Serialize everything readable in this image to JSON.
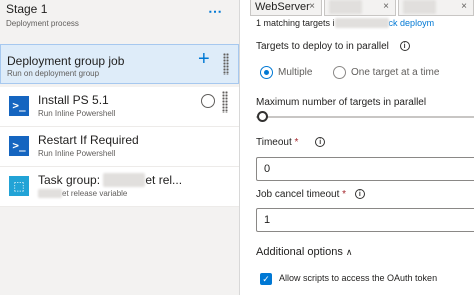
{
  "stage": {
    "title": "Stage 1",
    "subtitle": "Deployment process",
    "more_icon": "⋯"
  },
  "job": {
    "title": "Deployment group job",
    "subtitle": "Run on deployment group",
    "add_icon": "+"
  },
  "tasks": [
    {
      "icon": ">_",
      "title": "Install PS 5.1",
      "subtitle": "Run Inline Powershell"
    },
    {
      "icon": ">_",
      "title": "Restart If Required",
      "subtitle": "Run Inline Powershell"
    },
    {
      "icon": "⬚",
      "title_prefix": "Task group: ",
      "title_redacted": "xxxxxxx",
      "title_suffix": "et rel...",
      "subtitle_redacted": "xxxxxx",
      "subtitle_suffix": "et release variable"
    }
  ],
  "tabs": [
    {
      "label": "WebServer",
      "close": "×"
    },
    {
      "label": "",
      "close": "×"
    },
    {
      "label": "",
      "close": "×"
    }
  ],
  "matching": {
    "prefix": "1 matching targets i",
    "redacted": "xxxxxxxxxxxx",
    "link_suffix": "ck deploym"
  },
  "parallel": {
    "label": "Targets to deploy to in parallel",
    "info_icon": "i",
    "options": [
      "Multiple",
      "One target at a time"
    ],
    "selected": "Multiple"
  },
  "max_targets": {
    "label": "Maximum number of targets in parallel",
    "value_fraction": 0
  },
  "timeout": {
    "label": "Timeout",
    "required": "*",
    "info_icon": "i",
    "value": "0"
  },
  "cancel_timeout": {
    "label": "Job cancel timeout",
    "required": "*",
    "info_icon": "i",
    "value": "1"
  },
  "additional": {
    "label": "Additional options",
    "chevron": "∧"
  },
  "oauth": {
    "label": "Allow scripts to access the OAuth token",
    "checked": true,
    "check_icon": "✓"
  },
  "colors": {
    "accent": "#0078d4",
    "selected_bg": "#deecf9",
    "ps_icon": "#1565c0",
    "taskgroup_icon": "#22a3d6"
  }
}
